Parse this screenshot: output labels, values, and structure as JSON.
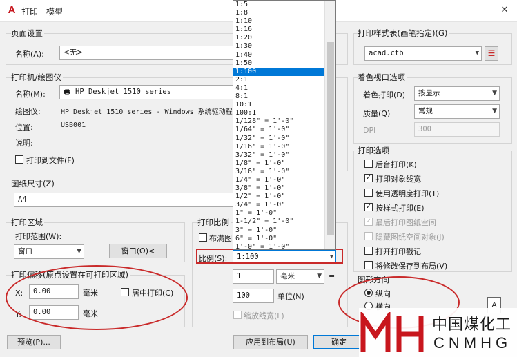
{
  "window": {
    "title": "打印 - 模型",
    "minimize": "—",
    "close": "✕"
  },
  "page_setup": {
    "group_label": "页面设置",
    "name_label": "名称(A):",
    "name_value": "<无>"
  },
  "plotter": {
    "group_label": "打印机/绘图仪",
    "name_label": "名称(M):",
    "name_value": "HP Deskjet 1510 series",
    "plotter_label": "绘图仪:",
    "plotter_value": "HP Deskjet 1510 series - Windows 系统驱动程",
    "location_label": "位置:",
    "location_value": "USB001",
    "desc_label": "说明:",
    "print_to_file": "打印到文件(F)"
  },
  "paper_size": {
    "group_label": "图纸尺寸(Z)",
    "value": "A4"
  },
  "plot_area": {
    "group_label": "打印区域",
    "range_label": "打印范围(W):",
    "range_value": "窗口",
    "window_button": "窗口(O)<"
  },
  "plot_offset": {
    "group_label": "打印偏移(原点设置在可打印区域)",
    "x_label": "X:",
    "x_value": "0.00",
    "y_label": "Y:",
    "y_value": "0.00",
    "unit": "毫米",
    "center_plot": "居中打印(C)"
  },
  "plot_scale": {
    "group_label": "打印比例",
    "fit_paper": "布满图",
    "scale_label": "比例(S):",
    "scale_value": "1:100",
    "value1": "1",
    "unit_value": "毫米",
    "equals": "=",
    "value2": "100",
    "unit_label": "单位(N)",
    "scale_lineweights": "缩放线宽(L)"
  },
  "scale_list": {
    "items": [
      "1:5",
      "1:8",
      "1:10",
      "1:16",
      "1:20",
      "1:30",
      "1:40",
      "1:50",
      "1:100",
      "2:1",
      "4:1",
      "8:1",
      "10:1",
      "100:1",
      "1/128\" = 1'-0\"",
      "1/64\" = 1'-0\"",
      "1/32\" = 1'-0\"",
      "1/16\" = 1'-0\"",
      "3/32\" = 1'-0\"",
      "1/8\" = 1'-0\"",
      "3/16\" = 1'-0\"",
      "1/4\" = 1'-0\"",
      "3/8\" = 1'-0\"",
      "1/2\" = 1'-0\"",
      "3/4\" = 1'-0\"",
      "1\" = 1'-0\"",
      "1-1/2\" = 1'-0\"",
      "3\" = 1'-0\"",
      "6\" = 1'-0\"",
      "1'-0\" = 1'-0\""
    ],
    "selected_index": 8
  },
  "plot_style": {
    "group_label": "打印样式表(画笔指定)(G)",
    "value": "acad.ctb"
  },
  "shaded_viewport": {
    "group_label": "着色视口选项",
    "shade_label": "着色打印(D)",
    "shade_value": "按显示",
    "quality_label": "质量(Q)",
    "quality_value": "常规",
    "dpi_label": "DPI",
    "dpi_value": "300"
  },
  "plot_options": {
    "group_label": "打印选项",
    "items": [
      {
        "label": "后台打印(K)",
        "checked": false,
        "disabled": false
      },
      {
        "label": "打印对象线宽",
        "checked": true,
        "disabled": false
      },
      {
        "label": "使用透明度打印(T)",
        "checked": false,
        "disabled": false
      },
      {
        "label": "按样式打印(E)",
        "checked": true,
        "disabled": false
      },
      {
        "label": "最后打印图纸空间",
        "checked": true,
        "disabled": true
      },
      {
        "label": "隐藏图纸空间对象(J)",
        "checked": false,
        "disabled": true
      },
      {
        "label": "打开打印戳记",
        "checked": false,
        "disabled": false
      },
      {
        "label": "将修改保存到布局(V)",
        "checked": false,
        "disabled": false
      }
    ]
  },
  "orientation": {
    "group_label": "图形方向",
    "portrait": "纵向",
    "landscape": "横向",
    "paper_letter": "A"
  },
  "buttons": {
    "preview": "预览(P)...",
    "apply_layout": "应用到布局(U)",
    "ok": "确定"
  },
  "watermark": {
    "cn": "中国煤化工",
    "en": "CNMHG"
  },
  "colors": {
    "accent": "#0078d7",
    "annotation": "#c92a2a",
    "app_icon": "#c7161d"
  }
}
